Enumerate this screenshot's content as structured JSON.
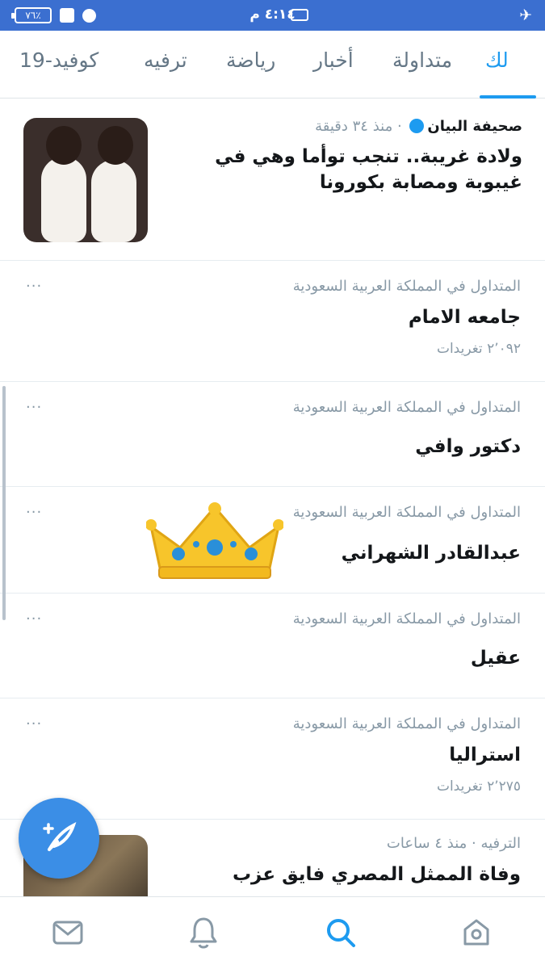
{
  "status_bar": {
    "battery": "٧٦٪",
    "time": "٤:١٤ م"
  },
  "tabs": [
    {
      "label": "لك",
      "active": true
    },
    {
      "label": "متداولة",
      "active": false
    },
    {
      "label": "أخبار",
      "active": false
    },
    {
      "label": "رياضة",
      "active": false
    },
    {
      "label": "ترفيه",
      "active": false
    },
    {
      "label": "كوفيد-19",
      "active": false
    }
  ],
  "news": {
    "source": "صحيفة البيان",
    "time": "منذ ٣٤ دقيقة",
    "title": "ولادة غريبة.. تنجب توأما وهي في غيبوبة ومصابة بكورونا"
  },
  "trends": [
    {
      "context": "المتداول في المملكة العربية السعودية",
      "name": "جامعه الامام",
      "count": "٢٬٠٩٢ تغريدات"
    },
    {
      "context": "المتداول في المملكة العربية السعودية",
      "name": "دكتور وافي",
      "count": ""
    },
    {
      "context": "المتداول في المملكة العربية السعودية",
      "name": "عبدالقادر الشهراني",
      "count": ""
    },
    {
      "context": "المتداول في المملكة العربية السعودية",
      "name": "عقيل",
      "count": ""
    },
    {
      "context": "المتداول في المملكة العربية السعودية",
      "name": "استراليا",
      "count": "٢٬٢٧٥ تغريدات"
    }
  ],
  "bottom_news": {
    "meta": "الترفيه · منذ ٤ ساعات",
    "title": "وفاة الممثل المصري فايق عزب"
  },
  "more_glyph": "···",
  "colors": {
    "accent": "#1d9bf0",
    "status_bar": "#3b6fd0",
    "fab": "#3b8ee6"
  },
  "icons": {
    "nav": [
      "mail-icon",
      "bell-icon",
      "search-icon",
      "home-icon"
    ],
    "fab": "compose-feather-icon"
  }
}
